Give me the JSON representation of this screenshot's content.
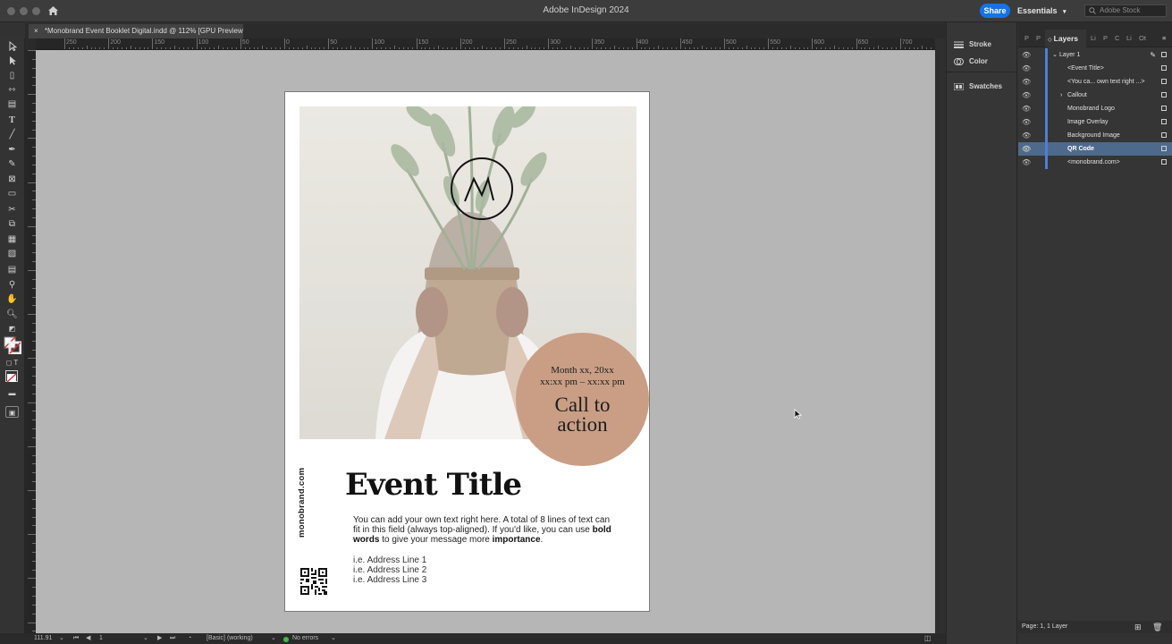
{
  "app": {
    "title": "Adobe InDesign 2024",
    "share_label": "Share",
    "workspace": "Essentials",
    "stock_placeholder": "Adobe Stock"
  },
  "document": {
    "tab_close": "×",
    "tab_label": "*Monobrand Event Booklet Digital.indd @ 112% [GPU Preview]"
  },
  "ruler": {
    "labels": [
      "250",
      "200",
      "150",
      "100",
      "50",
      "0",
      "50",
      "100",
      "150",
      "200",
      "250",
      "300",
      "350",
      "400",
      "450",
      "500",
      "550",
      "600",
      "650",
      "700"
    ]
  },
  "page": {
    "logo_text": "M",
    "callout_date": "Month xx, 20xx",
    "callout_time": "xx:xx pm – xx:xx pm",
    "callout_cta_line1": "Call to",
    "callout_cta_line2": "action",
    "vertical_url": "monobrand.com",
    "event_title": "Event Title",
    "body_part1": "You can add your own text right here. A total of 8 lines of text can fit in this field (always top-aligned). If you'd like, you can use ",
    "body_bold1": "bold words",
    "body_part2": " to give your message more ",
    "body_bold2": "importance",
    "body_end": ".",
    "address_lines": [
      "i.e. Address Line 1",
      "i.e. Address Line 2",
      "i.e. Address Line 3"
    ]
  },
  "dock": {
    "stroke": "Stroke",
    "color": "Color",
    "swatches": "Swatches"
  },
  "layers_panel": {
    "tabs_left": [
      "P",
      "P"
    ],
    "active_tab": "Layers",
    "tabs_right": [
      "Li",
      "P",
      "C",
      "Li",
      "Ot"
    ],
    "layer_name": "Layer 1",
    "items": [
      "<Event Title>",
      "<You ca... own text right ...>",
      "Callout",
      "Monobrand Logo",
      "Image Overlay",
      "Background Image",
      "QR Code",
      "<monobrand.com>"
    ],
    "selected_item": "QR Code",
    "footer": "Page: 1, 1 Layer"
  },
  "status": {
    "zoom": "111.91",
    "page_number": "1",
    "style": "[Basic] (working)",
    "errors": "No errors"
  },
  "colors": {
    "accent_blue": "#1473e6",
    "callout_fill": "#c99e85",
    "selection": "#4d6a8c",
    "layer_color": "#4e7ed6"
  }
}
